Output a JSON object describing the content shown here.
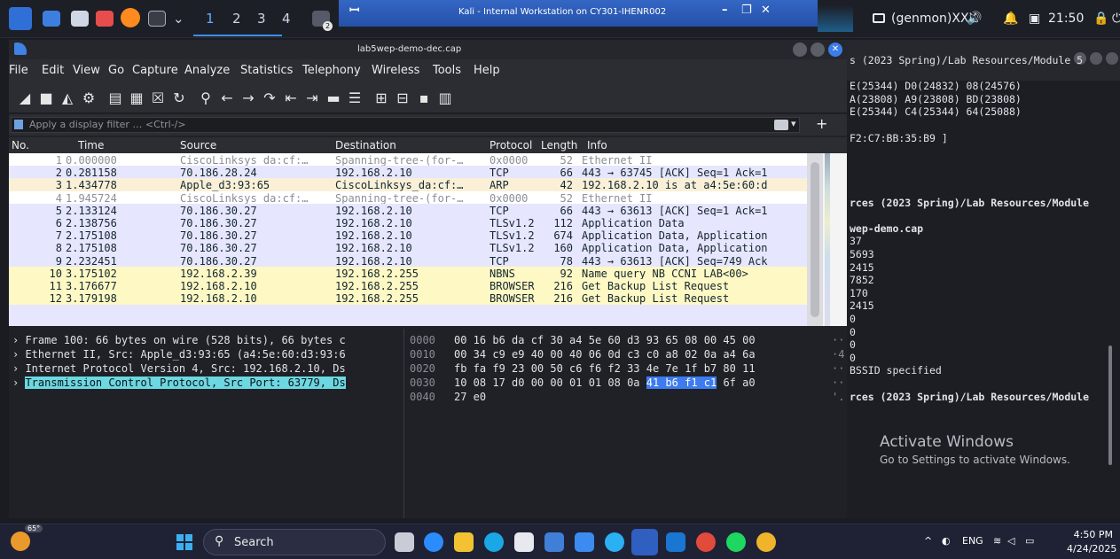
{
  "kali_panel": {
    "workspaces": [
      "1",
      "2",
      "3",
      "4"
    ],
    "vm_title": "Kali - Internal Workstation on CY301-IHENR002",
    "genmon": "(genmon)XXX",
    "time": "21:50",
    "notif_badge": "2"
  },
  "wireshark": {
    "title": "lab5wep-demo-dec.cap",
    "menu": [
      "File",
      "Edit",
      "View",
      "Go",
      "Capture",
      "Analyze",
      "Statistics",
      "Telephony",
      "Wireless",
      "Tools",
      "Help"
    ],
    "filter_placeholder": "Apply a display filter … <Ctrl-/>",
    "columns": [
      "No.",
      "Time",
      "Source",
      "Destination",
      "Protocol",
      "Length",
      "Info"
    ],
    "packets": [
      {
        "no": "1",
        "time": "0.000000",
        "src": "CiscoLinksys_da:cf:…",
        "dst": "Spanning-tree-(for-…",
        "proto": "0x0000",
        "len": "52",
        "info": "Ethernet II",
        "color": "#ffffff",
        "fg": "#8b8f96"
      },
      {
        "no": "2",
        "time": "0.281158",
        "src": "70.186.28.24",
        "dst": "192.168.2.10",
        "proto": "TCP",
        "len": "66",
        "info": "443 → 63745 [ACK] Seq=1 Ack=1",
        "color": "#e7e6ff",
        "fg": "#12272e"
      },
      {
        "no": "3",
        "time": "1.434778",
        "src": "Apple_d3:93:65",
        "dst": "CiscoLinksys_da:cf:…",
        "proto": "ARP",
        "len": "42",
        "info": "192.168.2.10 is at a4:5e:60:d",
        "color": "#faf0d7",
        "fg": "#12272e"
      },
      {
        "no": "4",
        "time": "1.945724",
        "src": "CiscoLinksys_da:cf:…",
        "dst": "Spanning-tree-(for-…",
        "proto": "0x0000",
        "len": "52",
        "info": "Ethernet II",
        "color": "#ffffff",
        "fg": "#8b8f96"
      },
      {
        "no": "5",
        "time": "2.133124",
        "src": "70.186.30.27",
        "dst": "192.168.2.10",
        "proto": "TCP",
        "len": "66",
        "info": "443 → 63613 [ACK] Seq=1 Ack=1",
        "color": "#e7e6ff",
        "fg": "#12272e"
      },
      {
        "no": "6",
        "time": "2.138756",
        "src": "70.186.30.27",
        "dst": "192.168.2.10",
        "proto": "TLSv1.2",
        "len": "112",
        "info": "Application Data",
        "color": "#e7e6ff",
        "fg": "#12272e"
      },
      {
        "no": "7",
        "time": "2.175108",
        "src": "70.186.30.27",
        "dst": "192.168.2.10",
        "proto": "TLSv1.2",
        "len": "674",
        "info": "Application Data, Application",
        "color": "#e7e6ff",
        "fg": "#12272e"
      },
      {
        "no": "8",
        "time": "2.175108",
        "src": "70.186.30.27",
        "dst": "192.168.2.10",
        "proto": "TLSv1.2",
        "len": "160",
        "info": "Application Data, Application",
        "color": "#e7e6ff",
        "fg": "#12272e"
      },
      {
        "no": "9",
        "time": "2.232451",
        "src": "70.186.30.27",
        "dst": "192.168.2.10",
        "proto": "TCP",
        "len": "78",
        "info": "443 → 63613 [ACK] Seq=749 Ack",
        "color": "#e7e6ff",
        "fg": "#12272e"
      },
      {
        "no": "10",
        "time": "3.175102",
        "src": "192.168.2.39",
        "dst": "192.168.2.255",
        "proto": "NBNS",
        "len": "92",
        "info": "Name query NB CCNI_LAB<00>",
        "color": "#fef8c4",
        "fg": "#12272e"
      },
      {
        "no": "11",
        "time": "3.176677",
        "src": "192.168.2.10",
        "dst": "192.168.2.255",
        "proto": "BROWSER",
        "len": "216",
        "info": "Get Backup List Request",
        "color": "#fef8c4",
        "fg": "#12272e"
      },
      {
        "no": "12",
        "time": "3.179198",
        "src": "192.168.2.10",
        "dst": "192.168.2.255",
        "proto": "BROWSER",
        "len": "216",
        "info": "Get Backup List Request",
        "color": "#fef8c4",
        "fg": "#12272e"
      }
    ],
    "details": [
      "Frame 100: 66 bytes on wire (528 bits), 66 bytes c",
      "Ethernet II, Src: Apple_d3:93:65 (a4:5e:60:d3:93:6",
      "Internet Protocol Version 4, Src: 192.168.2.10, Ds",
      "Transmission Control Protocol, Src Port: 63779, Ds"
    ],
    "bytes": [
      {
        "ofs": "0000",
        "pre": "00 16 b6 da cf 30 a4 5e  60 d3 93 65 08 00 45 00",
        "hl": "",
        "post": "",
        "asc": "··"
      },
      {
        "ofs": "0010",
        "pre": "00 34 c9 e9 40 00 40 06  0d c3 c0 a8 02 0a a4 6a",
        "hl": "",
        "post": "",
        "asc": "·4"
      },
      {
        "ofs": "0020",
        "pre": "fb fa f9 23 00 50 c6 f6  f2 33 4e 7e 1f b7 80 11",
        "hl": "",
        "post": "",
        "asc": "··"
      },
      {
        "ofs": "0030",
        "pre": "10 08 17 d0 00 00 01 01  08 0a ",
        "hl": "41 b6 f1 c1",
        "post": " 6f a0",
        "asc": "··"
      },
      {
        "ofs": "0040",
        "pre": "27 e0",
        "hl": "",
        "post": "",
        "asc": "'."
      }
    ]
  },
  "terminal": {
    "lines": [
      {
        "t": "s (2023 Spring)/Lab Resources/Module 5",
        "b": false
      },
      {
        "t": "",
        "b": false
      },
      {
        "t": "E(25344) D0(24832) 08(24576)",
        "b": false
      },
      {
        "t": "A(23808) A9(23808) BD(23808)",
        "b": false
      },
      {
        "t": "E(25344) C4(25344) 64(25088)",
        "b": false
      },
      {
        "t": "",
        "b": false
      },
      {
        "t": "F2:C7:BB:35:B9 ]",
        "b": false
      },
      {
        "t": "",
        "b": false
      },
      {
        "t": "",
        "b": false
      },
      {
        "t": "",
        "b": false
      },
      {
        "t": "",
        "b": false
      },
      {
        "t": "rces (2023 Spring)/Lab Resources/Module",
        "b": true
      },
      {
        "t": "",
        "b": false
      },
      {
        "t": "wep-demo.cap",
        "b": true
      },
      {
        "t": " 37",
        "b": false
      },
      {
        "t": "5693",
        "b": false
      },
      {
        "t": "2415",
        "b": false
      },
      {
        "t": "7852",
        "b": false
      },
      {
        "t": " 170",
        "b": false
      },
      {
        "t": "2415",
        "b": false
      },
      {
        "t": "  0",
        "b": false
      },
      {
        "t": "  0",
        "b": false
      },
      {
        "t": "  0",
        "b": false
      },
      {
        "t": "  0",
        "b": false
      },
      {
        "t": "BSSID specified",
        "b": false
      },
      {
        "t": "",
        "b": false
      },
      {
        "t": "rces (2023 Spring)/Lab Resources/Module",
        "b": true
      }
    ],
    "activate_title": "Activate Windows",
    "activate_sub": "Go to Settings to activate Windows."
  },
  "taskbar": {
    "weather_temp": "65°",
    "search_label": "Search",
    "lang": "ENG",
    "time": "4:50 PM",
    "date": "4/24/2025"
  }
}
